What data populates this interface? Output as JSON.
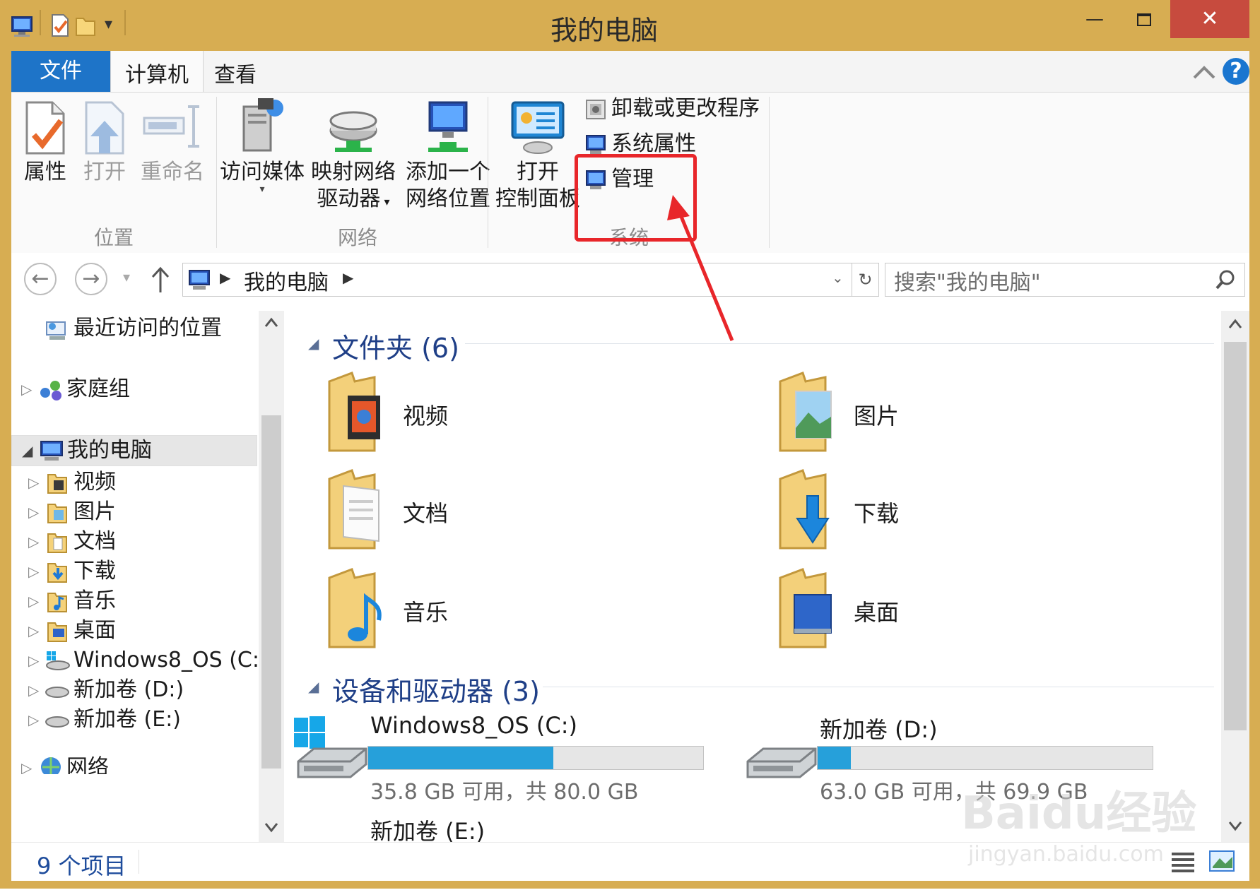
{
  "window": {
    "title": "我的电脑"
  },
  "ribbon": {
    "tabs": [
      {
        "label": "文件"
      },
      {
        "label": "计算机"
      },
      {
        "label": "查看"
      }
    ],
    "location": {
      "group_label": "位置",
      "properties": "属性",
      "open": "打开",
      "rename": "重命名"
    },
    "network": {
      "group_label": "网络",
      "access_media": "访问媒体",
      "map_drive_line1": "映射网络",
      "map_drive_line2": "驱动器",
      "add_location_line1": "添加一个",
      "add_location_line2": "网络位置"
    },
    "system": {
      "group_label": "系统",
      "open_cp_line1": "打开",
      "open_cp_line2": "控制面板",
      "uninstall": "卸载或更改程序",
      "system_properties": "系统属性",
      "manage": "管理"
    },
    "help_glyph": "?"
  },
  "address": {
    "path": "我的电脑",
    "search_placeholder": "搜索\"我的电脑\""
  },
  "navpane": {
    "items": [
      {
        "label": "最近访问的位置"
      },
      {
        "label": "家庭组"
      },
      {
        "label": "我的电脑"
      },
      {
        "label": "视频"
      },
      {
        "label": "图片"
      },
      {
        "label": "文档"
      },
      {
        "label": "下载"
      },
      {
        "label": "音乐"
      },
      {
        "label": "桌面"
      },
      {
        "label": "Windows8_OS (C:"
      },
      {
        "label": "新加卷 (D:)"
      },
      {
        "label": "新加卷 (E:)"
      },
      {
        "label": "网络"
      }
    ]
  },
  "content": {
    "folders_header": "文件夹 (6)",
    "folders": [
      {
        "label": "视频"
      },
      {
        "label": "图片"
      },
      {
        "label": "文档"
      },
      {
        "label": "下载"
      },
      {
        "label": "音乐"
      },
      {
        "label": "桌面"
      }
    ],
    "drives_header": "设备和驱动器 (3)",
    "drives": [
      {
        "name": "Windows8_OS (C:)",
        "info": "35.8 GB 可用，共 80.0 GB",
        "used_fraction": 0.5525
      },
      {
        "name": "新加卷 (D:)",
        "info": "63.0 GB 可用，共 69.9 GB",
        "used_fraction": 0.0987
      },
      {
        "name": "新加卷 (E:)"
      }
    ]
  },
  "status": {
    "item_count": "9 个项目"
  },
  "watermark": {
    "brand": "Baidu经验",
    "url": "jingyan.baidu.com"
  },
  "colors": {
    "title_bar": "#d7ad52",
    "file_tab": "#1e74c8",
    "highlight": "#e8262a",
    "drive_fill": "#26a0da",
    "section_header": "#1f3f87"
  }
}
